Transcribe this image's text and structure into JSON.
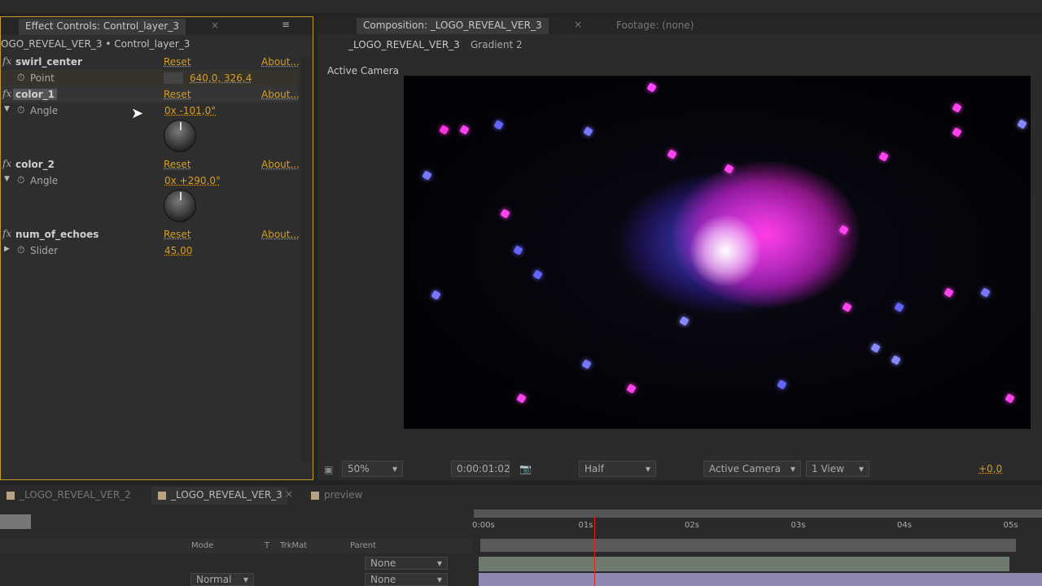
{
  "effect_controls": {
    "tab_label": "Effect Controls: Control_layer_3",
    "breadcrumb": "OGO_REVEAL_VER_3 • Control_layer_3",
    "effects": [
      {
        "name": "swirl_center",
        "reset": "Reset",
        "about": "About...",
        "param": "Point",
        "value": "640,0, 326,4"
      },
      {
        "name": "color_1",
        "reset": "Reset",
        "about": "About...",
        "param": "Angle",
        "value": "0x -101,0°"
      },
      {
        "name": "color_2",
        "reset": "Reset",
        "about": "About...",
        "param": "Angle",
        "value": "0x +290,0°"
      },
      {
        "name": "num_of_echoes",
        "reset": "Reset",
        "about": "About...",
        "param": "Slider",
        "value": "45,00"
      }
    ]
  },
  "composition": {
    "tab_label": "Composition: _LOGO_REVEAL_VER_3",
    "footage_label": "Footage: (none)",
    "crumbs": [
      "_LOGO_REVEAL_VER_3",
      "Gradient 2"
    ],
    "camera_label": "Active Camera",
    "toolbar": {
      "zoom": "50%",
      "timecode": "0:00:01:02",
      "resolution": "Half",
      "camera": "Active Camera",
      "views": "1 View",
      "exposure": "+0,0"
    }
  },
  "timeline": {
    "tabs": [
      "_LOGO_REVEAL_VER_2",
      "_LOGO_REVEAL_VER_3",
      "preview"
    ],
    "columns": {
      "mode": "Mode",
      "t": "T",
      "trkmat": "TrkMat",
      "parent": "Parent"
    },
    "ticks": [
      "0:00s",
      "01s",
      "02s",
      "03s",
      "04s",
      "05s"
    ],
    "layers": [
      {
        "mode": "",
        "parent": "None"
      },
      {
        "mode": "Normal",
        "parent": "None"
      }
    ],
    "playhead_seconds": 1.07
  },
  "colors": {
    "accent": "#d59e27",
    "playhead": "#e02020"
  }
}
